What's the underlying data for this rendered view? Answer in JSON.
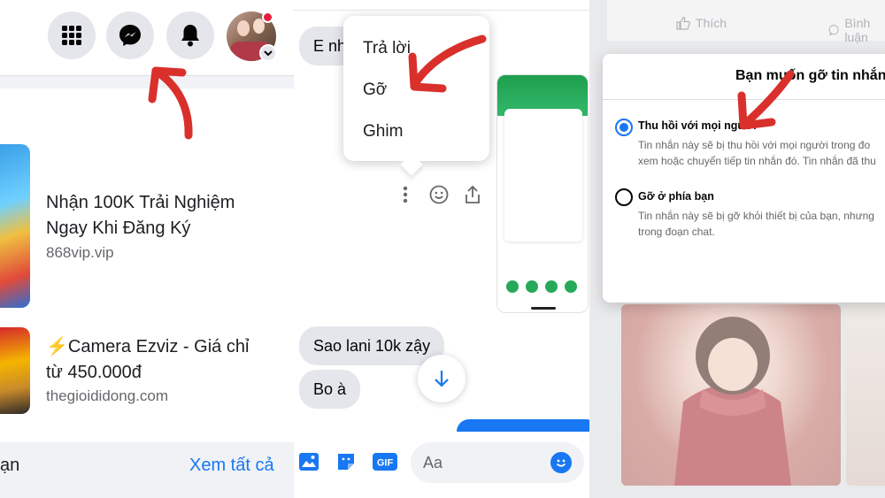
{
  "panel1": {
    "ads": [
      {
        "title_line1": "Nhận 100K Trải Nghiệm",
        "title_line2": "Ngay Khi Đăng Ký",
        "domain": "868vip.vip"
      },
      {
        "title_line1": "⚡Camera Ezviz - Giá chỉ",
        "title_line2": "từ 450.000đ",
        "domain": "thegioididong.com"
      }
    ],
    "footer_left": "ạn",
    "see_all": "Xem tất cả"
  },
  "panel2": {
    "messages": [
      "E nh",
      "Sao lani 10k zậy",
      "Bo à"
    ],
    "menu": [
      "Trả lời",
      "Gỡ",
      "Ghim"
    ],
    "composer_placeholder": "Aa",
    "gif_label": "GIF"
  },
  "panel3": {
    "actions": [
      "Thích",
      "Bình luận"
    ],
    "dialog_title": "Bạn muốn gỡ tin nhắn",
    "options": [
      {
        "label": "Thu hồi với mọi người",
        "selected": true,
        "desc_line1": "Tin nhắn này sẽ bị thu hồi với mọi người trong đo",
        "desc_line2": "xem hoặc chuyển tiếp tin nhắn đó. Tin nhắn đã thu"
      },
      {
        "label": "Gỡ ở phía bạn",
        "selected": false,
        "desc_line1": "Tin nhắn này sẽ bị gỡ khỏi thiết bị của bạn, nhưng",
        "desc_line2": "trong đoạn chat."
      }
    ]
  },
  "colors": {
    "accent": "#1877f2",
    "annotation_arrow": "#d9302c",
    "notification_dot": "#e41e3f"
  },
  "icons": [
    "grid-menu-icon",
    "messenger-icon",
    "bell-icon",
    "more-vertical-icon",
    "smiley-icon",
    "share-icon",
    "arrow-down-icon",
    "image-icon",
    "sticker-icon",
    "gif-icon",
    "emoji-icon",
    "like-icon",
    "comment-icon"
  ]
}
